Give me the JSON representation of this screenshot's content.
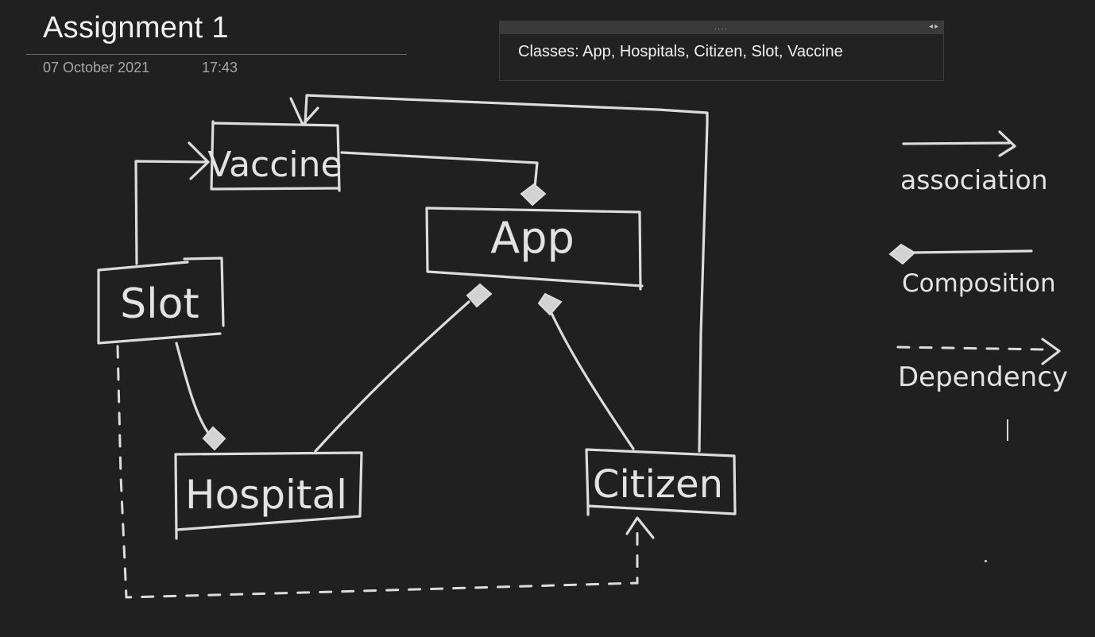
{
  "page": {
    "title": "Assignment 1",
    "date": "07 October 2021",
    "time": "17:43"
  },
  "note": {
    "text": "Classes: App, Hospitals, Citizen, Slot, Vaccine",
    "grip": "....",
    "arrows": "◂▸"
  },
  "diagram": {
    "classes": {
      "vaccine": "Vaccine",
      "app": "App",
      "slot": "Slot",
      "hospital": "Hospital",
      "citizen": "Citizen"
    },
    "legend": {
      "association": "association",
      "composition": "Composition",
      "dependency": "Dependency"
    }
  },
  "colors": {
    "background": "#202020",
    "ink": "#dcdcdc",
    "title": "#f0f0f0",
    "meta": "#a6a6a6"
  }
}
